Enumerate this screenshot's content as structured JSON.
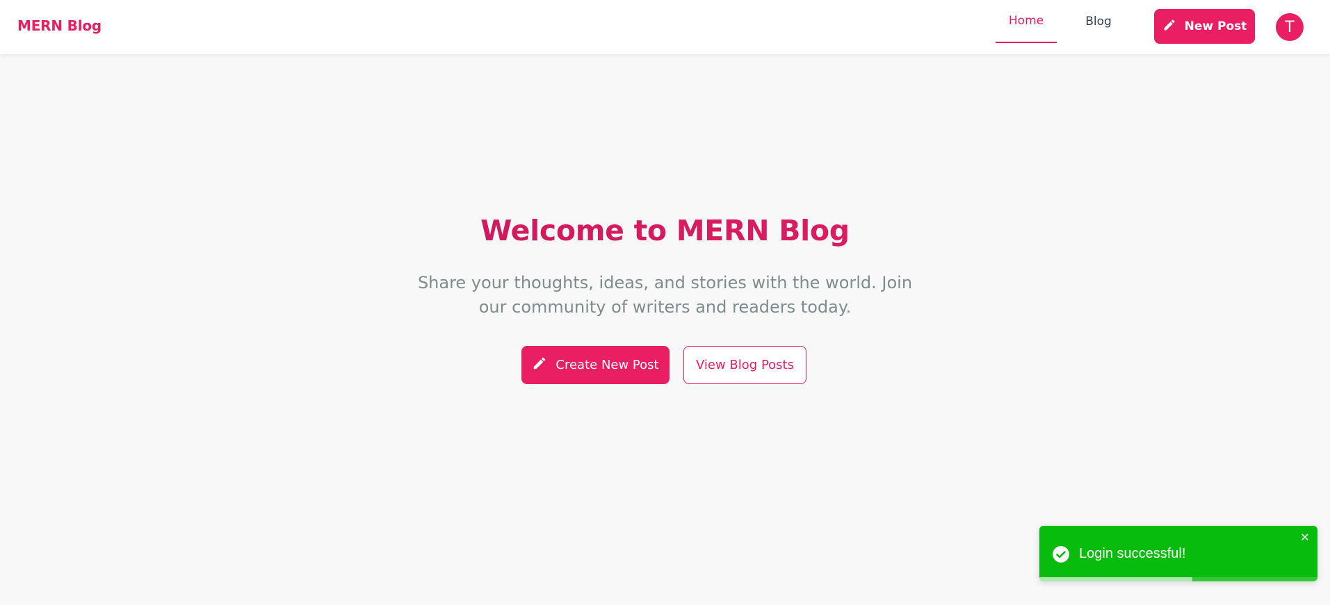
{
  "nav": {
    "brand": "MERN Blog",
    "links": [
      {
        "label": "Home",
        "active": true
      },
      {
        "label": "Blog",
        "active": false
      }
    ],
    "new_post_label": "New Post",
    "avatar_initial": "T"
  },
  "hero": {
    "title": "Welcome to MERN Blog",
    "subtitle": "Share your thoughts, ideas, and stories with the world. Join our community of writers and readers today.",
    "create_label": "Create New Post",
    "view_label": "View Blog Posts"
  },
  "toast": {
    "message": "Login successful!",
    "close_symbol": "✕",
    "progress_remaining": 0.55,
    "icon": "check-circle-icon"
  },
  "colors": {
    "accent": "#e91e63",
    "toast_success": "#07bc0c",
    "text_dark": "#2c3e50",
    "text_muted": "#7f8c8d"
  }
}
